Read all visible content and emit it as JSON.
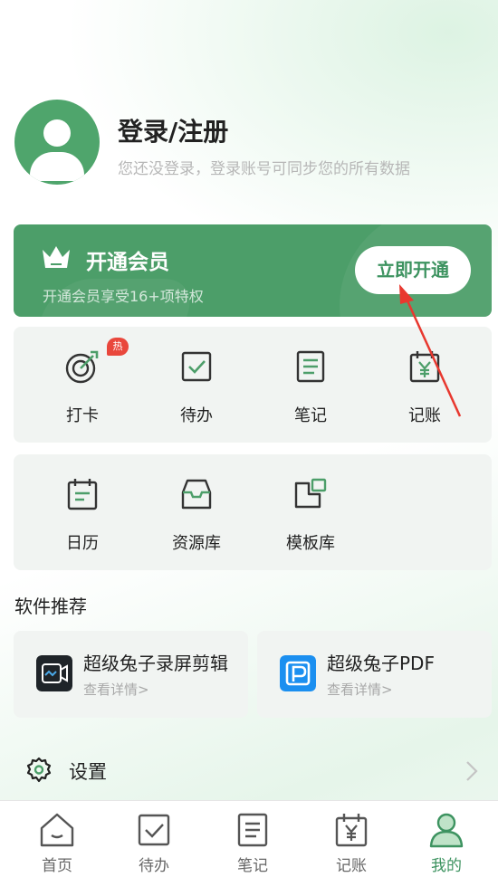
{
  "profile": {
    "title": "登录/注册",
    "subtitle": "您还没登录，登录账号可同步您的所有数据"
  },
  "vip": {
    "title": "开通会员",
    "subtitle": "开通会员享受16+项特权",
    "button": "立即开通"
  },
  "tools_row1": [
    {
      "label": "打卡",
      "icon": "checkin-target-icon",
      "badge": "热"
    },
    {
      "label": "待办",
      "icon": "todo-check-icon"
    },
    {
      "label": "笔记",
      "icon": "note-icon"
    },
    {
      "label": "记账",
      "icon": "ledger-yen-icon"
    }
  ],
  "tools_row2": [
    {
      "label": "日历",
      "icon": "calendar-icon"
    },
    {
      "label": "资源库",
      "icon": "inbox-tray-icon"
    },
    {
      "label": "模板库",
      "icon": "template-icon"
    }
  ],
  "software": {
    "title": "软件推荐",
    "apps": [
      {
        "name": "超级兔子录屏剪辑",
        "link": "查看详情>",
        "icon": "screen-recorder-app-icon"
      },
      {
        "name": "超级兔子PDF",
        "link": "查看详情>",
        "icon": "pdf-app-icon"
      }
    ]
  },
  "settings": {
    "label": "设置"
  },
  "nav": [
    {
      "label": "首页",
      "icon": "home-icon"
    },
    {
      "label": "待办",
      "icon": "todo-check-icon"
    },
    {
      "label": "笔记",
      "icon": "note-icon"
    },
    {
      "label": "记账",
      "icon": "ledger-yen-icon"
    },
    {
      "label": "我的",
      "icon": "profile-icon",
      "active": true
    }
  ],
  "colors": {
    "brand_green": "#4c9e69",
    "active_green": "#3d9360",
    "hot_red": "#e9473c",
    "annotation_red": "#e8382f"
  }
}
